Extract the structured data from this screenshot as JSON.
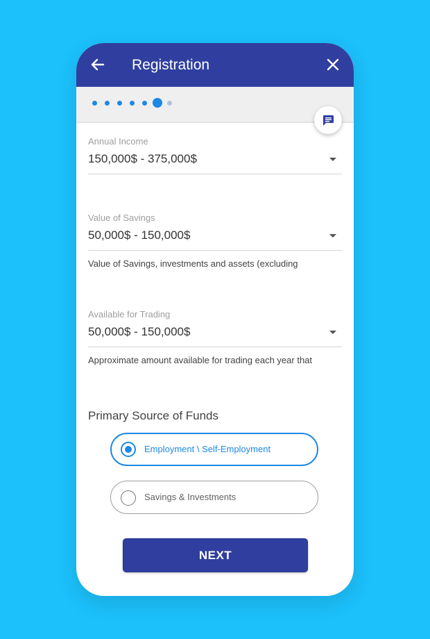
{
  "header": {
    "title": "Registration",
    "back_icon": "arrow-left-icon",
    "close_icon": "close-icon",
    "color": "#303f9f"
  },
  "progress": {
    "total_steps": 7,
    "current_step": 6,
    "active_color": "#1e88e5",
    "inactive_color": "#b0c4de"
  },
  "chat_button": {
    "icon": "chat-message-icon"
  },
  "fields": {
    "annual_income": {
      "label": "Annual Income",
      "value": "150,000$ - 375,000$"
    },
    "value_of_savings": {
      "label": "Value of Savings",
      "value": "50,000$ - 150,000$",
      "helper": "Value of Savings, investments and assets (excluding"
    },
    "available_for_trading": {
      "label": "Available for Trading",
      "value": "50,000$ - 150,000$",
      "helper": "Approximate amount available for trading each year that"
    }
  },
  "source_of_funds": {
    "title": "Primary Source of Funds",
    "options": [
      {
        "label": "Employment \\ Self-Employment",
        "selected": true
      },
      {
        "label": "Savings & Investments",
        "selected": false
      }
    ]
  },
  "next_button": {
    "label": "NEXT"
  },
  "colors": {
    "background": "#1cc0fb",
    "accent": "#1e88e5",
    "primary": "#303f9f"
  }
}
